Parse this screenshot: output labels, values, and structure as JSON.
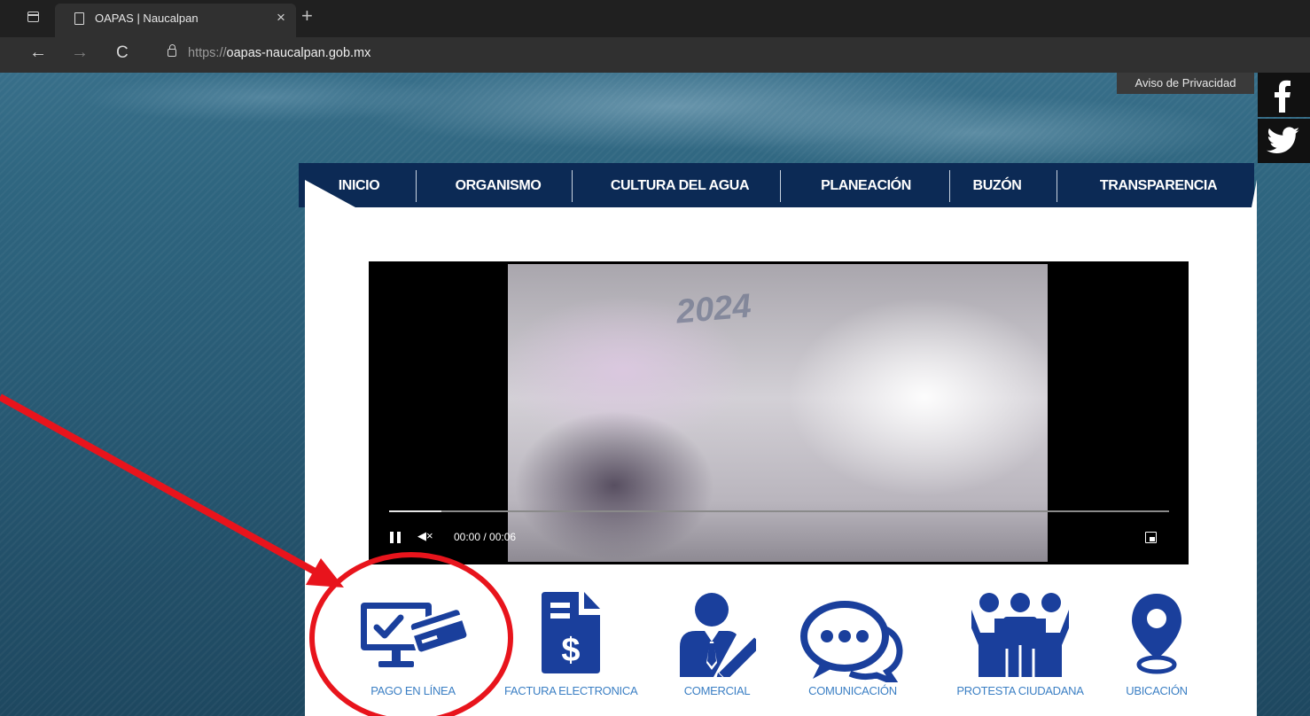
{
  "browser": {
    "tab_title": "OAPAS | Naucalpan",
    "tab_close": "×",
    "new_tab": "+",
    "url_prefix": "https://",
    "url_host": "oapas-naucalpan.gob.mx",
    "back": "←",
    "forward": "→",
    "reload": "C"
  },
  "topbar": {
    "privacy_link": "Aviso de Privacidad",
    "social": [
      "facebook-icon",
      "twitter-icon"
    ]
  },
  "nav": {
    "items": [
      {
        "label": "INICIO"
      },
      {
        "label": "ORGANISMO"
      },
      {
        "label": "CULTURA DEL AGUA"
      },
      {
        "label": "PLANEACIÓN"
      },
      {
        "label": "BUZÓN"
      },
      {
        "label": "TRANSPARENCIA"
      }
    ]
  },
  "video": {
    "frame_text": "2024",
    "time": "00:00 / 00:06",
    "progress_fraction": 0.067,
    "mute_symbol": "◀×"
  },
  "shortcuts": [
    {
      "label": "PAGO EN LÍNEA",
      "icon": "payment-monitor-icon"
    },
    {
      "label": "FACTURA ELECTRONICA",
      "icon": "invoice-dollar-icon"
    },
    {
      "label": "COMERCIAL",
      "icon": "businessman-icon"
    },
    {
      "label": "COMUNICACIÓN",
      "icon": "chat-bubbles-icon"
    },
    {
      "label": "PROTESTA CIUDADANA",
      "icon": "crowd-icon"
    },
    {
      "label": "UBICACIÓN",
      "icon": "location-pin-icon"
    }
  ],
  "colors": {
    "nav_bg": "#0c2a55",
    "icon_blue": "#1a3f9c",
    "label_blue": "#3b7fc4",
    "annotation_red": "#e8141c"
  }
}
